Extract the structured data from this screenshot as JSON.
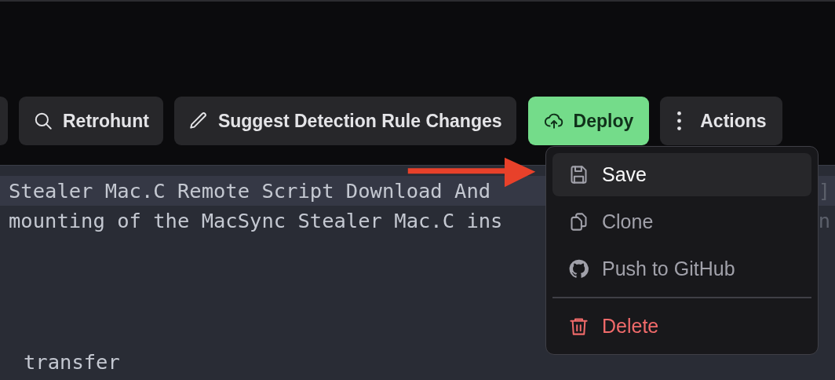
{
  "toolbar": {
    "buttons": [
      {
        "label": "Retrohunt",
        "kind": "search"
      },
      {
        "label": "Suggest Detection Rule Changes",
        "kind": "edit"
      },
      {
        "label": "Deploy",
        "kind": "deploy"
      },
      {
        "label": "Actions",
        "kind": "more"
      }
    ]
  },
  "editor": {
    "lines": [
      {
        "text": "Stealer Mac.C Remote Script Download And",
        "tail": "]",
        "highlighted": true
      },
      {
        "text": "mounting of the MacSync Stealer Mac.C ins",
        "tail": "n",
        "highlighted": false
      }
    ],
    "last_line": "transfer"
  },
  "actions_menu": {
    "groups": [
      {
        "items": [
          {
            "label": "Save",
            "kind": "save",
            "selected": true
          },
          {
            "label": "Clone",
            "kind": "clone",
            "selected": false
          },
          {
            "label": "Push to GitHub",
            "kind": "github",
            "selected": false
          }
        ]
      },
      {
        "items": [
          {
            "label": "Delete",
            "kind": "delete",
            "selected": false
          }
        ]
      }
    ]
  }
}
